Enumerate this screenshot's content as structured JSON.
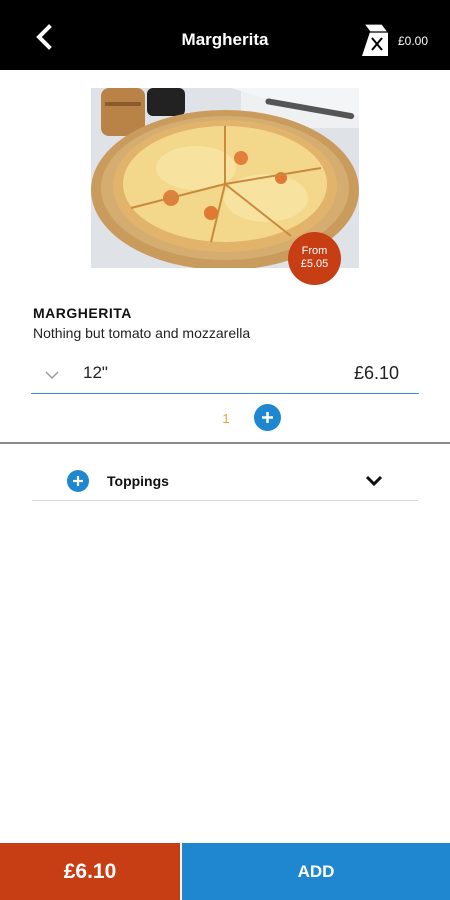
{
  "header": {
    "title": "Margherita",
    "basket_total": "£0.00",
    "back_icon": "chevron-left-icon",
    "basket_icon": "pizza-box-icon"
  },
  "product": {
    "image": "margherita-pizza-photo",
    "badge_line1": "From",
    "badge_line2": "£5.05",
    "name": "MARGHERITA",
    "description": "Nothing but tomato and mozzarella"
  },
  "size": {
    "selected": "12\"",
    "price": "£6.10"
  },
  "quantity": {
    "value": "1"
  },
  "toppings": {
    "label": "Toppings"
  },
  "footer": {
    "total": "£6.10",
    "add_label": "ADD"
  },
  "colors": {
    "topbar": "#000000",
    "accent_red": "#c73d14",
    "accent_blue": "#1f86d0",
    "quantity_text": "#e8a33a"
  }
}
